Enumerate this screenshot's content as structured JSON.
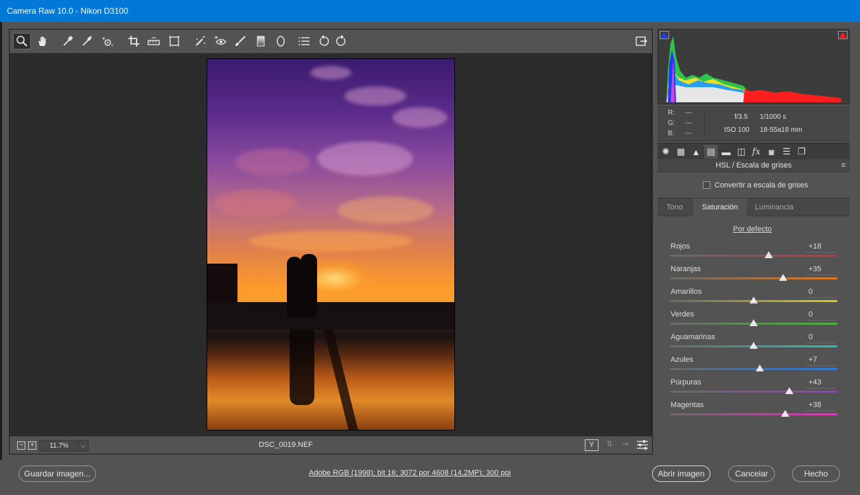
{
  "window": {
    "title": "Camera Raw 10.0 -  Nikon D3100"
  },
  "toolbar": {
    "tools": [
      {
        "name": "zoom-tool",
        "icon": "zoom-icon"
      },
      {
        "name": "hand-tool",
        "icon": "hand-icon"
      },
      {
        "name": "white-balance-tool",
        "icon": "eyedropper-icon"
      },
      {
        "name": "color-sampler-tool",
        "icon": "color-sampler-icon"
      },
      {
        "name": "targeted-adjustment-tool",
        "icon": "target-adjust-icon"
      },
      {
        "name": "crop-tool",
        "icon": "crop-icon"
      },
      {
        "name": "straighten-tool",
        "icon": "straighten-icon"
      },
      {
        "name": "transform-tool",
        "icon": "transform-icon"
      },
      {
        "name": "spot-removal-tool",
        "icon": "spot-removal-icon"
      },
      {
        "name": "red-eye-tool",
        "icon": "red-eye-icon"
      },
      {
        "name": "adjustment-brush-tool",
        "icon": "brush-icon"
      },
      {
        "name": "graduated-filter-tool",
        "icon": "graduated-filter-icon"
      },
      {
        "name": "radial-filter-tool",
        "icon": "radial-filter-icon"
      },
      {
        "name": "preferences-tool",
        "icon": "list-icon"
      },
      {
        "name": "rotate-left-tool",
        "icon": "rotate-left-icon"
      },
      {
        "name": "rotate-right-tool",
        "icon": "rotate-right-icon"
      }
    ],
    "fullscreen_icon": "fullscreen-icon"
  },
  "preview": {
    "zoom_minus": "−",
    "zoom_plus": "+",
    "zoom_level": "11.7%",
    "zoom_dropdown": "⌵",
    "filename": "DSC_0019.NEF"
  },
  "readout": {
    "r_label": "R:",
    "g_label": "G:",
    "b_label": "B:",
    "r_value": "---",
    "g_value": "---",
    "b_value": "---",
    "aperture": "f/3.5",
    "shutter": "1/1000 s",
    "iso": "ISO 100",
    "lens": "18-55a18 mm"
  },
  "panel": {
    "title": "HSL / Escala de grises",
    "convert_label": "Convertir a escala de grises",
    "convert_checked": false,
    "tabs": [
      "Tono",
      "Saturación",
      "Luminancia"
    ],
    "active_tab": "Saturación",
    "defaults_label": "Por defecto",
    "sliders": [
      {
        "label": "Rojos",
        "value": "+18",
        "num": 18
      },
      {
        "label": "Naranjas",
        "value": "+35",
        "num": 35
      },
      {
        "label": "Amarillos",
        "value": "0",
        "num": 0
      },
      {
        "label": "Verdes",
        "value": "0",
        "num": 0
      },
      {
        "label": "Aguamarinas",
        "value": "0",
        "num": 0
      },
      {
        "label": "Azules",
        "value": "+7",
        "num": 7
      },
      {
        "label": "Púrpuras",
        "value": "+43",
        "num": 43
      },
      {
        "label": "Magentas",
        "value": "+38",
        "num": 38
      }
    ],
    "track_colors": [
      "#c8323c",
      "#e07a1e",
      "#d8c81e",
      "#4ab43c",
      "#2ec0b4",
      "#2a78d8",
      "#9a3cc8",
      "#d83cb4"
    ]
  },
  "footer": {
    "save_label": "Guardar imagen...",
    "workflow_link": "Adobe RGB (1998); bit 16; 3072 por 4608 (14,2MP); 300 ppi",
    "open_label": "Abrir imagen",
    "cancel_label": "Cancelar",
    "done_label": "Hecho"
  }
}
